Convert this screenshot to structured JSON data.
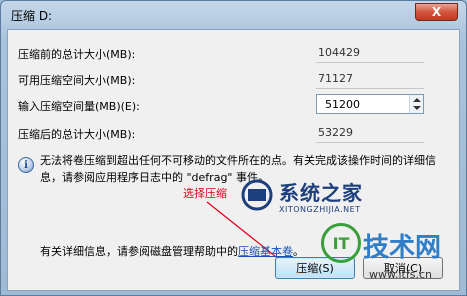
{
  "window": {
    "title": "压缩 D:",
    "close_glyph": "X"
  },
  "fields": [
    {
      "label": "压缩前的总计大小(MB):",
      "value": "104429"
    },
    {
      "label": "可用压缩空间大小(MB):",
      "value": "71127"
    },
    {
      "label": "输入压缩空间量(MB)(E):",
      "value": "51200"
    },
    {
      "label": "压缩后的总计大小(MB):",
      "value": "53229"
    }
  ],
  "info": {
    "text": "无法将卷压缩到超出任何不可移动的文件所在的点。有关完成该操作时间的详细信息，请参阅应用程序日志中的 \"defrag\" 事件。"
  },
  "detail": {
    "text": "有关详细信息，请参阅磁盘管理帮助中的",
    "link": "压缩基本卷",
    "suffix": "。"
  },
  "annotation": {
    "text": "选择压缩"
  },
  "buttons": {
    "compress": "压缩(S)",
    "cancel": "取消(C)"
  },
  "watermarks": {
    "site1_title": "系统之家",
    "site1_sub": "XITONGZHIJIA.NET",
    "site2_mark": "IT",
    "site2_title": "技术网",
    "site2_url": "www.itfs.cn"
  },
  "colors": {
    "annotation": "#e0001a",
    "link": "#1a4fb5"
  }
}
